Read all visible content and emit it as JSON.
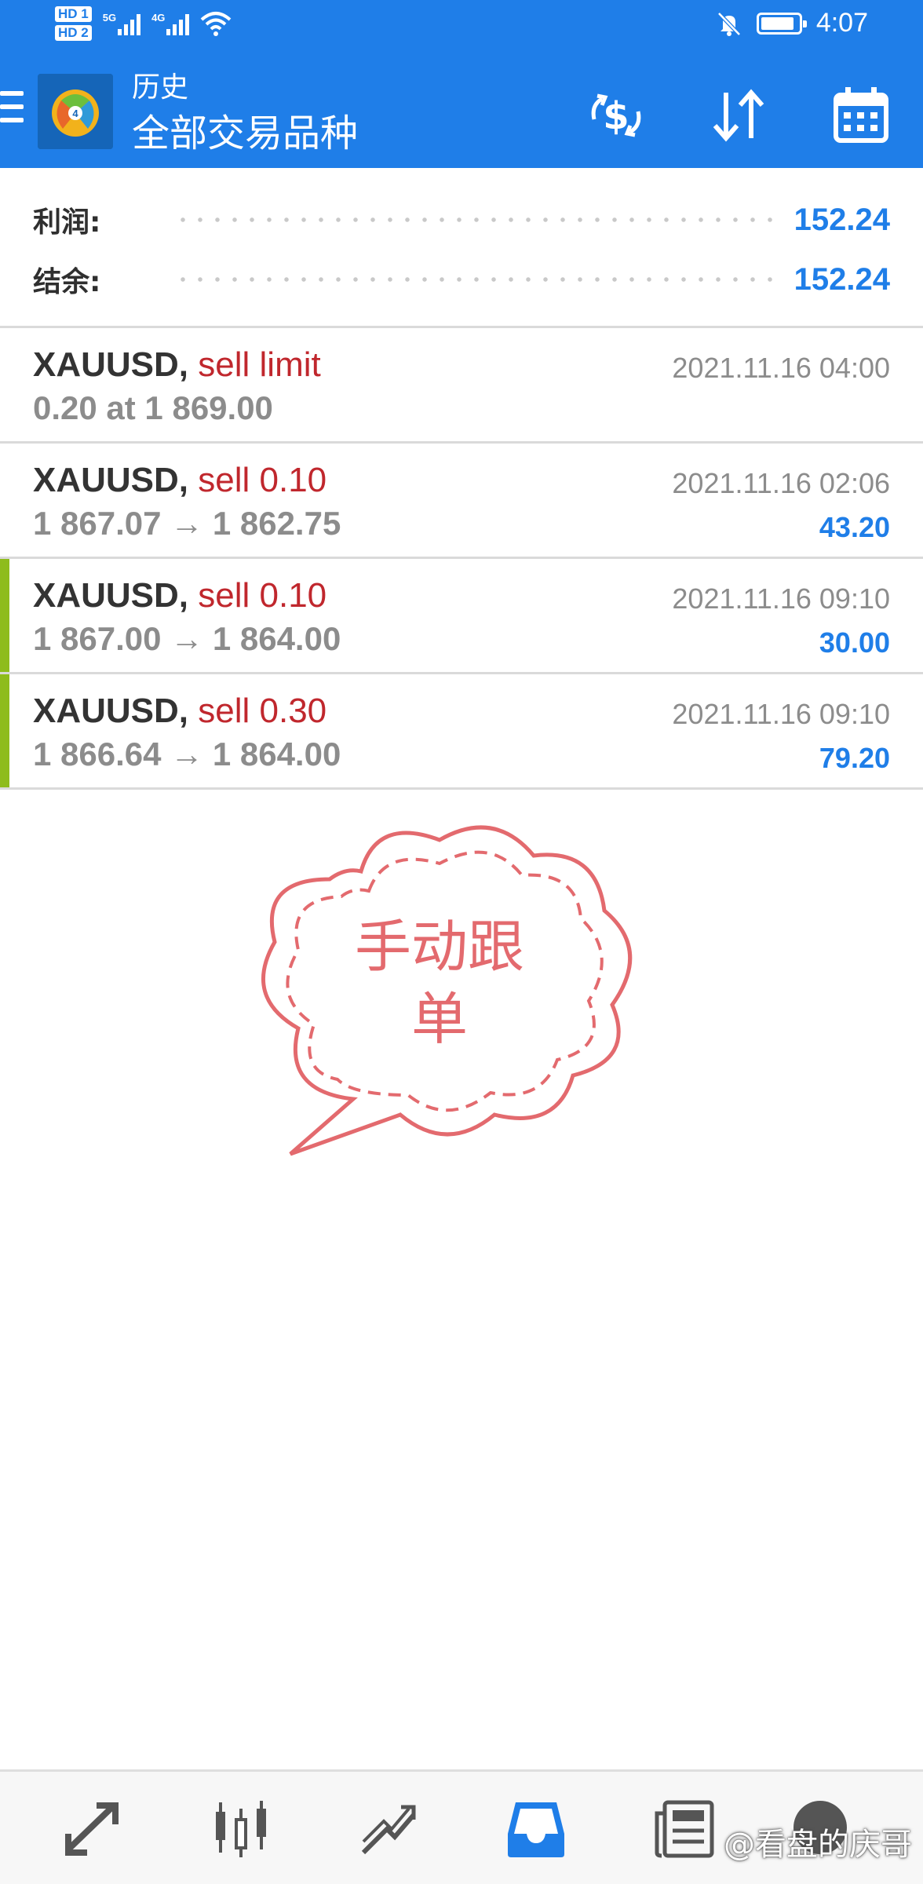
{
  "status_bar": {
    "sim1": "HD 1",
    "sim2": "HD 2",
    "net1": "5G",
    "net2": "4G",
    "time": "4:07",
    "battery_level": 0.9
  },
  "header": {
    "subtitle": "历史",
    "title": "全部交易品种",
    "actions": [
      "deposit-withdraw-icon",
      "sort-icon",
      "calendar-icon"
    ]
  },
  "summary": {
    "profit_label": "利润:",
    "profit_value": "152.24",
    "balance_label": "结余:",
    "balance_value": "152.24"
  },
  "trades": [
    {
      "symbol": "XAUUSD,",
      "side": "sell limit",
      "detail": "0.20 at 1 869.00",
      "time": "2021.11.16 04:00",
      "profit": "",
      "accent": false
    },
    {
      "symbol": "XAUUSD,",
      "side": "sell 0.10",
      "detail": "1 867.07 → 1 862.75",
      "time": "2021.11.16 02:06",
      "profit": "43.20",
      "accent": false
    },
    {
      "symbol": "XAUUSD,",
      "side": "sell 0.10",
      "detail": "1 867.00 → 1 864.00",
      "time": "2021.11.16 09:10",
      "profit": "30.00",
      "accent": true
    },
    {
      "symbol": "XAUUSD,",
      "side": "sell 0.30",
      "detail": "1 866.64 → 1 864.00",
      "time": "2021.11.16 09:10",
      "profit": "79.20",
      "accent": true
    }
  ],
  "sticker": {
    "line1": "手动跟",
    "line2": "单"
  },
  "bottom_nav": {
    "items": [
      "quotes-icon",
      "chart-icon",
      "trade-icon",
      "history-icon",
      "news-icon",
      "chat-icon"
    ],
    "active": "history-icon"
  },
  "watermark": "@看盘的庆哥",
  "colors": {
    "brand_blue": "#1f7ee8",
    "sell_red": "#c0272d",
    "accent_green": "#8ebc1c",
    "sticker_pink": "#e36a6e"
  }
}
